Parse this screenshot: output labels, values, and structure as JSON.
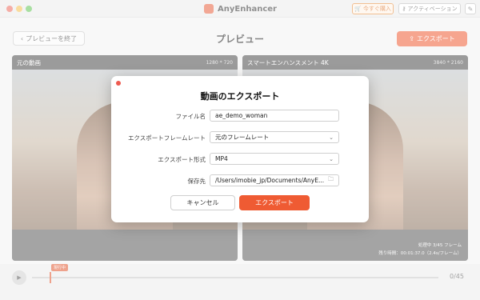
{
  "window": {
    "title": "AnyEnhancer",
    "buy_label": "今すぐ購入",
    "activate_label": "アクティベーション",
    "light_colors": [
      "#ed6a5e",
      "#f5bf4f",
      "#61c554"
    ]
  },
  "toolbar": {
    "back_label": "プレビューを終了",
    "page_title": "プレビュー",
    "export_label": "エクスポート",
    "accent": "#ef5b33"
  },
  "panels": {
    "original": {
      "title": "元の動画",
      "resolution": "1280 * 720"
    },
    "enhanced": {
      "title": "スマートエンハンスメント 4K",
      "resolution": "3840 * 2160",
      "status_line1": "処理中 3/45 フレーム",
      "status_line2": "残り時間：00:01:37.0（2.4s/フレーム）"
    }
  },
  "timeline": {
    "current_label": "現行中",
    "counter": "0/45"
  },
  "dialog": {
    "title": "動画のエクスポート",
    "filename_label": "ファイル名",
    "filename_value": "ae_demo_woman",
    "framerate_label": "エクスポートフレームレート",
    "framerate_value": "元のフレームレート",
    "format_label": "エクスポート形式",
    "format_value": "MP4",
    "dest_label": "保存先",
    "dest_value": "/Users/imobie_jp/Documents/AnyE...",
    "cancel_label": "キャンセル",
    "export_label": "エクスポート"
  }
}
